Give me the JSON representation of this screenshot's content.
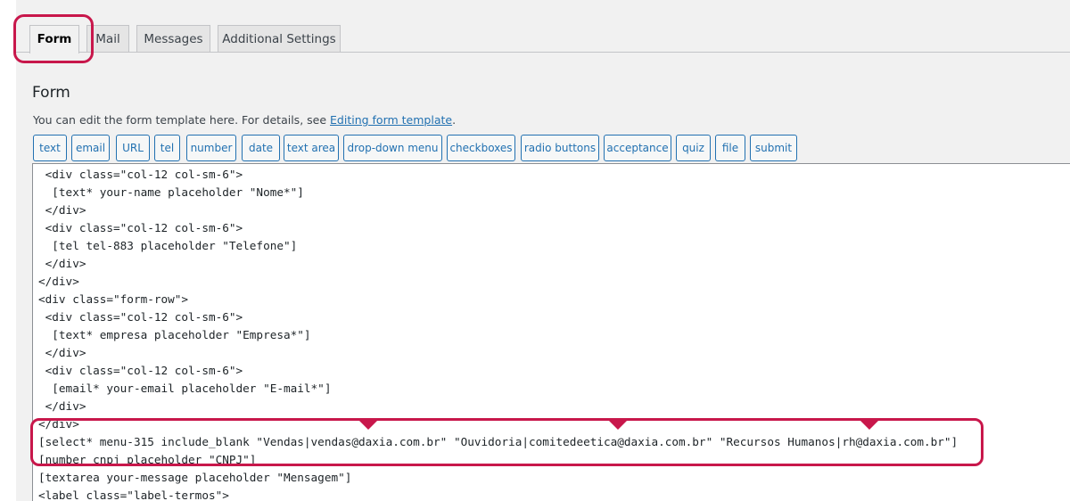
{
  "tabs": [
    {
      "label": "Form",
      "active": true
    },
    {
      "label": "Mail",
      "active": false
    },
    {
      "label": "Messages",
      "active": false
    },
    {
      "label": "Additional Settings",
      "active": false
    }
  ],
  "section": {
    "title": "Form",
    "help_text": "You can edit the form template here. For details, see ",
    "help_link": "Editing form template",
    "help_suffix": "."
  },
  "tag_buttons": [
    "text",
    "email",
    "URL",
    "tel",
    "number",
    "date",
    "text area",
    "drop-down menu",
    "checkboxes",
    "radio buttons",
    "acceptance",
    "quiz",
    "file",
    "submit"
  ],
  "code_lines": [
    " <div class=\"col-12 col-sm-6\">",
    "  [text* your-name placeholder \"Nome*\"]",
    " </div>",
    " <div class=\"col-12 col-sm-6\">",
    "  [tel tel-883 placeholder \"Telefone\"]",
    " </div>",
    "</div>",
    "<div class=\"form-row\">",
    " <div class=\"col-12 col-sm-6\">",
    "  [text* empresa placeholder \"Empresa*\"]",
    " </div>",
    " <div class=\"col-12 col-sm-6\">",
    "  [email* your-email placeholder \"E-mail*\"]",
    " </div>",
    "</div>",
    "[select* menu-315 include_blank \"Vendas|vendas@daxia.com.br\" \"Ouvidoria|comitedeetica@daxia.com.br\" \"Recursos Humanos|rh@daxia.com.br\"]",
    "[number cnpj placeholder \"CNPJ\"]",
    "[textarea your-message placeholder \"Mensagem\"]",
    "<label class=\"label-termos\">"
  ],
  "colors": {
    "highlight": "#c8174b",
    "link": "#2271b1"
  }
}
